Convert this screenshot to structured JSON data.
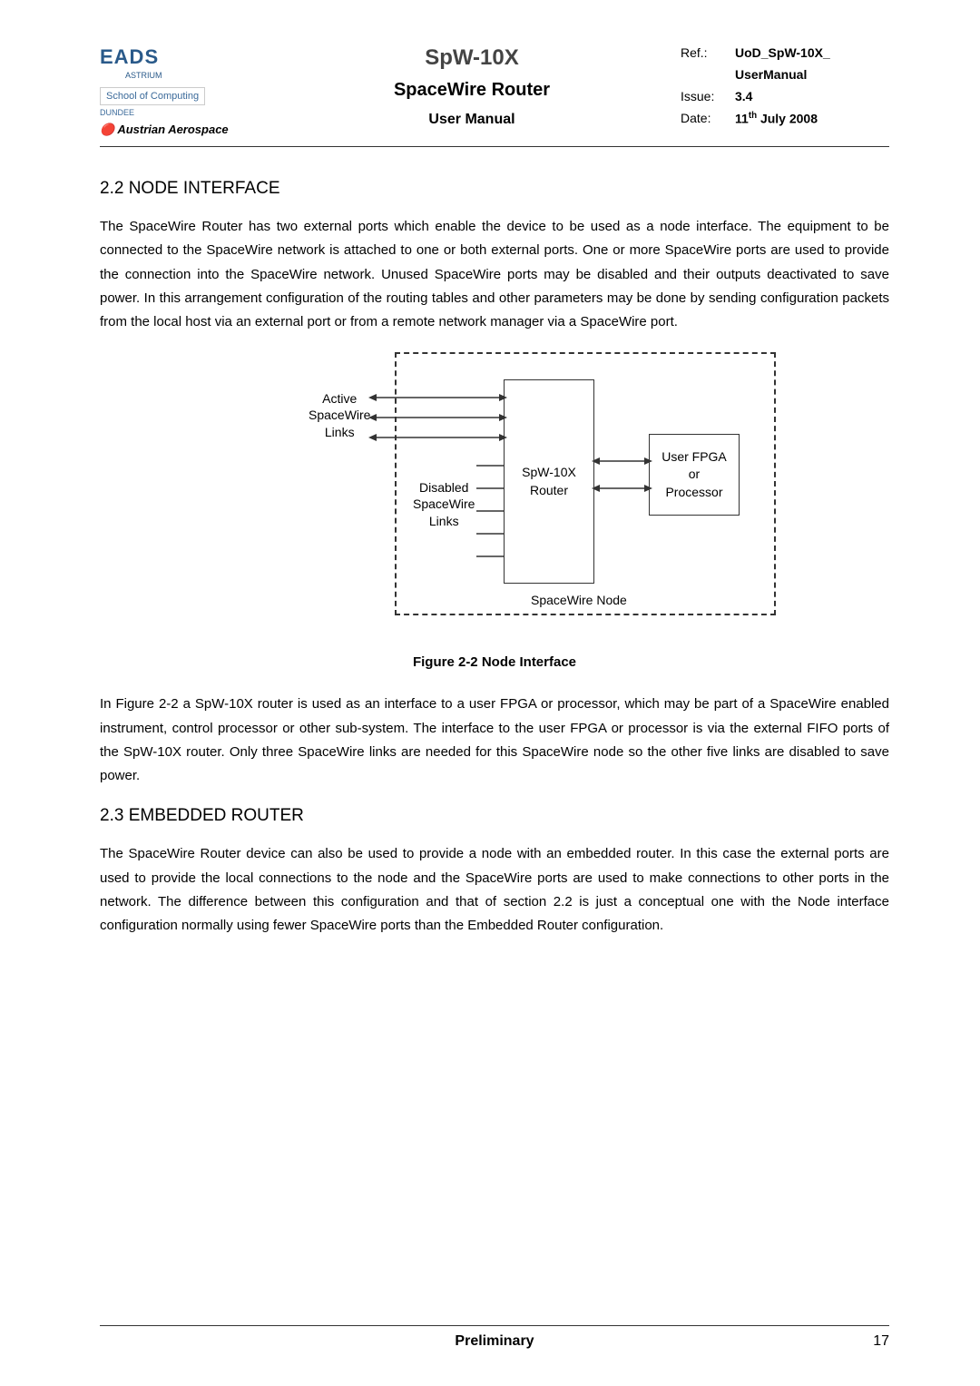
{
  "header": {
    "logo": {
      "eads": "EADS",
      "astrium": "ASTRIUM",
      "school": "School of Computing",
      "dundee": "DUNDEE",
      "austrian": "Austrian Aerospace"
    },
    "title": {
      "main": "SpW-10X",
      "sub": "SpaceWire Router",
      "third": "User Manual"
    },
    "meta": {
      "ref_label": "Ref.:",
      "ref_value": "UoD_SpW-10X_",
      "ref_value2": "UserManual",
      "issue_label": "Issue:",
      "issue_value": "3.4",
      "date_label": "Date:",
      "date_value": "11th July 2008"
    }
  },
  "section22": {
    "heading": "2.2  NODE INTERFACE",
    "para": "The SpaceWire Router has two external ports which enable the device to be used as a node interface. The equipment to be connected to the SpaceWire network is attached to one or both external ports. One or more SpaceWire ports are used to provide the connection into the SpaceWire network. Unused SpaceWire ports may be disabled and their outputs deactivated to save power. In this arrangement configuration of the routing tables and other parameters may be done by sending configuration packets from the local host via an external port or from a remote network manager via a SpaceWire port."
  },
  "figure": {
    "active_label": "Active\nSpaceWire\nLinks",
    "disabled_label": "Disabled\nSpaceWire\nLinks",
    "router_label": "SpW-10X\nRouter",
    "fpga_label": "User FPGA\nor\nProcessor",
    "node_label": "SpaceWire Node",
    "caption": "Figure 2-2 Node Interface"
  },
  "para2": "In Figure 2-2 a SpW-10X router is used as an interface to a user FPGA or processor, which may be part of a SpaceWire enabled instrument, control processor or other sub-system. The interface to the user FPGA or processor is via the external FIFO ports of the SpW-10X router. Only three SpaceWire links are needed for this SpaceWire node so the other five links are disabled to save power.",
  "section23": {
    "heading": "2.3  EMBEDDED ROUTER",
    "para": "The SpaceWire Router device can also be used to provide a node with an embedded router. In this case the external ports are used to provide the local connections to the node and the SpaceWire ports are used to make connections to other ports in the network. The difference between this configuration and that of section 2.2 is just a conceptual one with the Node interface configuration normally using fewer SpaceWire ports than the Embedded Router configuration."
  },
  "footer": {
    "center": "Preliminary",
    "page": "17"
  }
}
